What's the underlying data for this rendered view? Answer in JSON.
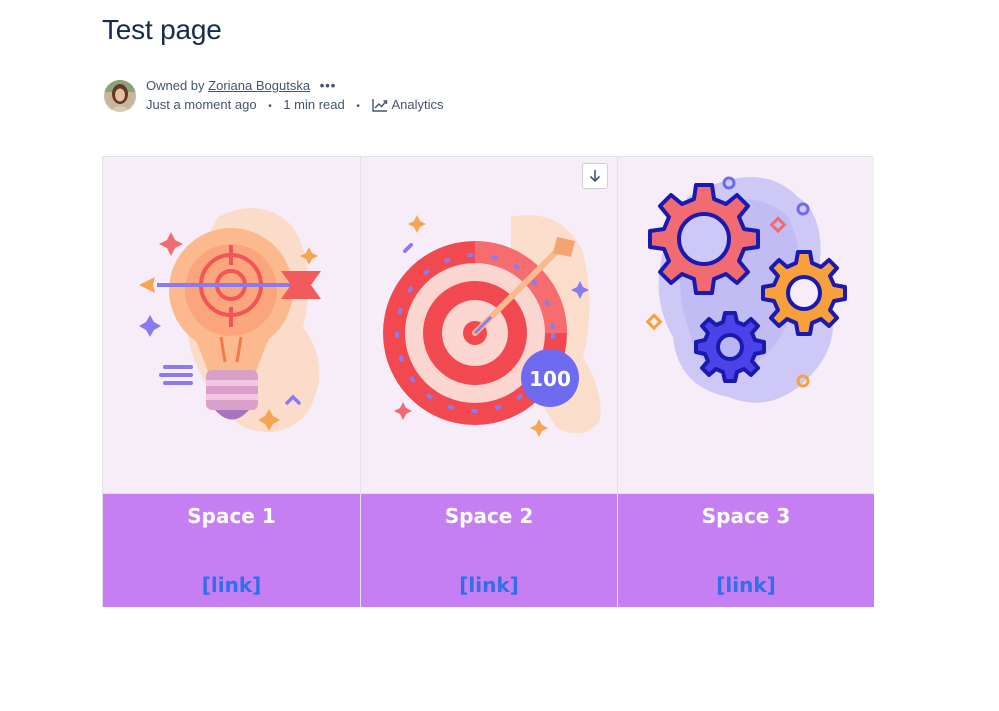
{
  "page": {
    "title": "Test page"
  },
  "byline": {
    "owned_by_prefix": "Owned by",
    "owner_name": "Zoriana Bogutska",
    "more_label": "•••",
    "timestamp": "Just a moment ago",
    "read_time": "1 min read",
    "separator": "•",
    "analytics_label": "Analytics"
  },
  "spaces": [
    {
      "title": "Space 1",
      "link": "[link]",
      "illustration": "lightbulb-target-icon"
    },
    {
      "title": "Space 2",
      "link": "[link]",
      "illustration": "dartboard-100-icon"
    },
    {
      "title": "Space 3",
      "link": "[link]",
      "illustration": "gears-icon"
    }
  ],
  "theme": {
    "card_bg": "#c67ef3",
    "image_bg": "#f6edf9",
    "title_color": "#ffffff",
    "link_color": "#2f6fea"
  },
  "icons": {
    "download": "download-arrow-icon",
    "analytics": "analytics-chart-icon"
  }
}
